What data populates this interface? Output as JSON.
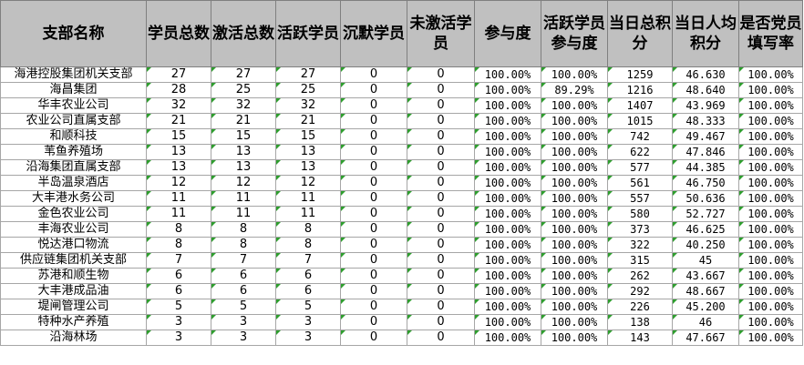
{
  "headers": [
    "支部名称",
    "学员总数",
    "激活总数",
    "活跃学员",
    "沉默学员",
    "未激活学员",
    "参与度",
    "活跃学员参与度",
    "当日总积分",
    "当日人均积分",
    "是否党员填写率"
  ],
  "rows": [
    [
      "海港控股集团机关支部",
      "27",
      "27",
      "27",
      "0",
      "0",
      "100.00%",
      "100.00%",
      "1259",
      "46.630",
      "100.00%"
    ],
    [
      "海昌集团",
      "28",
      "25",
      "25",
      "0",
      "0",
      "100.00%",
      "89.29%",
      "1216",
      "48.640",
      "100.00%"
    ],
    [
      "华丰农业公司",
      "32",
      "32",
      "32",
      "0",
      "0",
      "100.00%",
      "100.00%",
      "1407",
      "43.969",
      "100.00%"
    ],
    [
      "农业公司直属支部",
      "21",
      "21",
      "21",
      "0",
      "0",
      "100.00%",
      "100.00%",
      "1015",
      "48.333",
      "100.00%"
    ],
    [
      "和顺科技",
      "15",
      "15",
      "15",
      "0",
      "0",
      "100.00%",
      "100.00%",
      "742",
      "49.467",
      "100.00%"
    ],
    [
      "苇鱼养殖场",
      "13",
      "13",
      "13",
      "0",
      "0",
      "100.00%",
      "100.00%",
      "622",
      "47.846",
      "100.00%"
    ],
    [
      "沿海集团直属支部",
      "13",
      "13",
      "13",
      "0",
      "0",
      "100.00%",
      "100.00%",
      "577",
      "44.385",
      "100.00%"
    ],
    [
      "半岛温泉酒店",
      "12",
      "12",
      "12",
      "0",
      "0",
      "100.00%",
      "100.00%",
      "561",
      "46.750",
      "100.00%"
    ],
    [
      "大丰港水务公司",
      "11",
      "11",
      "11",
      "0",
      "0",
      "100.00%",
      "100.00%",
      "557",
      "50.636",
      "100.00%"
    ],
    [
      "金色农业公司",
      "11",
      "11",
      "11",
      "0",
      "0",
      "100.00%",
      "100.00%",
      "580",
      "52.727",
      "100.00%"
    ],
    [
      "丰海农业公司",
      "8",
      "8",
      "8",
      "0",
      "0",
      "100.00%",
      "100.00%",
      "373",
      "46.625",
      "100.00%"
    ],
    [
      "悦达港口物流",
      "8",
      "8",
      "8",
      "0",
      "0",
      "100.00%",
      "100.00%",
      "322",
      "40.250",
      "100.00%"
    ],
    [
      "供应链集团机关支部",
      "7",
      "7",
      "7",
      "0",
      "0",
      "100.00%",
      "100.00%",
      "315",
      "45",
      "100.00%"
    ],
    [
      "苏港和顺生物",
      "6",
      "6",
      "6",
      "0",
      "0",
      "100.00%",
      "100.00%",
      "262",
      "43.667",
      "100.00%"
    ],
    [
      "大丰港成品油",
      "6",
      "6",
      "6",
      "0",
      "0",
      "100.00%",
      "100.00%",
      "292",
      "48.667",
      "100.00%"
    ],
    [
      "堤闸管理公司",
      "5",
      "5",
      "5",
      "0",
      "0",
      "100.00%",
      "100.00%",
      "226",
      "45.200",
      "100.00%"
    ],
    [
      "特种水产养殖",
      "3",
      "3",
      "3",
      "0",
      "0",
      "100.00%",
      "100.00%",
      "138",
      "46",
      "100.00%"
    ],
    [
      "沿海林场",
      "3",
      "3",
      "3",
      "0",
      "0",
      "100.00%",
      "100.00%",
      "143",
      "47.667",
      "100.00%"
    ]
  ]
}
